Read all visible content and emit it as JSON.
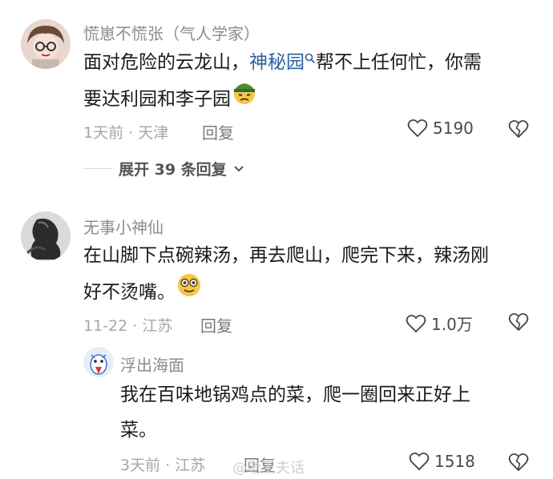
{
  "comments": [
    {
      "author": "慌崽不慌张（气人学家）",
      "text_before_link": "面对危险的云龙山，",
      "link": "神秘园",
      "text_after_link": "帮不上任何忙，你需",
      "text_line2": "要达利园和李子园",
      "emoji_icon": "frowning-face-with-hat-icon",
      "meta": "1天前 · 天津",
      "reply_label": "回复",
      "likes": "5190",
      "expand_label": "展开 39 条回复"
    },
    {
      "author": "无事小神仙",
      "text_line1": "在山脚下点碗辣汤，再去爬山，爬完下来，辣汤刚",
      "text_line2": "好不烫嘴。",
      "emoji_icon": "smiling-face-icon",
      "meta": "11-22 · 江苏",
      "reply_label": "回复",
      "likes": "1.0万"
    }
  ],
  "reply": {
    "author": "浮出海面",
    "text_line1": "我在百味地锅鸡点的菜，爬一圈回来正好上",
    "text_line2": "菜。",
    "meta": "3天前 · 江苏",
    "reply_label": "回复",
    "likes": "1518"
  },
  "watermark": "@老王夫话",
  "colors": {
    "link": "#2f5f9e",
    "secondary_text": "#8c8c8c"
  }
}
